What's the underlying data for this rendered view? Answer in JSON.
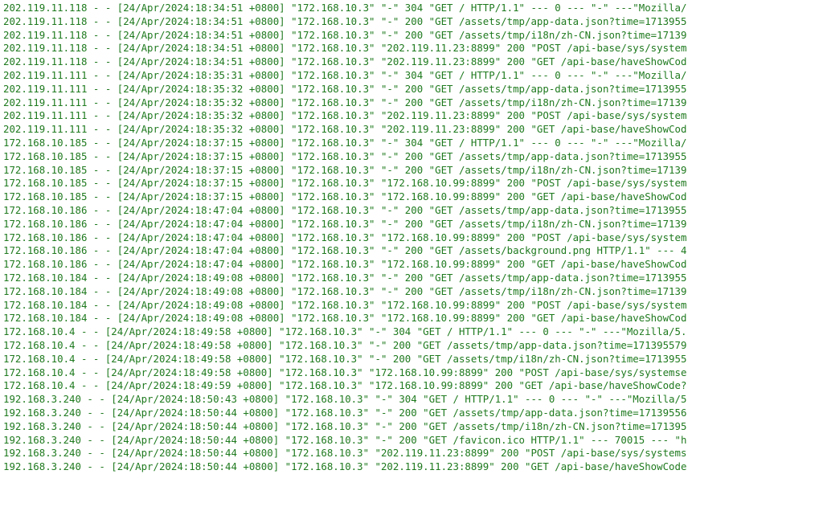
{
  "log_lines": [
    "202.119.11.118 - - [24/Apr/2024:18:34:51 +0800] \"172.168.10.3\" \"-\" 304 \"GET / HTTP/1.1\" --- 0 --- \"-\" ---\"Mozilla/",
    "202.119.11.118 - - [24/Apr/2024:18:34:51 +0800] \"172.168.10.3\" \"-\" 200 \"GET /assets/tmp/app-data.json?time=1713955",
    "202.119.11.118 - - [24/Apr/2024:18:34:51 +0800] \"172.168.10.3\" \"-\" 200 \"GET /assets/tmp/i18n/zh-CN.json?time=17139",
    "202.119.11.118 - - [24/Apr/2024:18:34:51 +0800] \"172.168.10.3\" \"202.119.11.23:8899\" 200 \"POST /api-base/sys/system",
    "202.119.11.118 - - [24/Apr/2024:18:34:51 +0800] \"172.168.10.3\" \"202.119.11.23:8899\" 200 \"GET /api-base/haveShowCod",
    "202.119.11.111 - - [24/Apr/2024:18:35:31 +0800] \"172.168.10.3\" \"-\" 304 \"GET / HTTP/1.1\" --- 0 --- \"-\" ---\"Mozilla/",
    "202.119.11.111 - - [24/Apr/2024:18:35:32 +0800] \"172.168.10.3\" \"-\" 200 \"GET /assets/tmp/app-data.json?time=1713955",
    "202.119.11.111 - - [24/Apr/2024:18:35:32 +0800] \"172.168.10.3\" \"-\" 200 \"GET /assets/tmp/i18n/zh-CN.json?time=17139",
    "202.119.11.111 - - [24/Apr/2024:18:35:32 +0800] \"172.168.10.3\" \"202.119.11.23:8899\" 200 \"POST /api-base/sys/system",
    "202.119.11.111 - - [24/Apr/2024:18:35:32 +0800] \"172.168.10.3\" \"202.119.11.23:8899\" 200 \"GET /api-base/haveShowCod",
    "172.168.10.185 - - [24/Apr/2024:18:37:15 +0800] \"172.168.10.3\" \"-\" 304 \"GET / HTTP/1.1\" --- 0 --- \"-\" ---\"Mozilla/",
    "172.168.10.185 - - [24/Apr/2024:18:37:15 +0800] \"172.168.10.3\" \"-\" 200 \"GET /assets/tmp/app-data.json?time=1713955",
    "172.168.10.185 - - [24/Apr/2024:18:37:15 +0800] \"172.168.10.3\" \"-\" 200 \"GET /assets/tmp/i18n/zh-CN.json?time=17139",
    "172.168.10.185 - - [24/Apr/2024:18:37:15 +0800] \"172.168.10.3\" \"172.168.10.99:8899\" 200 \"POST /api-base/sys/system",
    "172.168.10.185 - - [24/Apr/2024:18:37:15 +0800] \"172.168.10.3\" \"172.168.10.99:8899\" 200 \"GET /api-base/haveShowCod",
    "172.168.10.186 - - [24/Apr/2024:18:47:04 +0800] \"172.168.10.3\" \"-\" 200 \"GET /assets/tmp/app-data.json?time=1713955",
    "172.168.10.186 - - [24/Apr/2024:18:47:04 +0800] \"172.168.10.3\" \"-\" 200 \"GET /assets/tmp/i18n/zh-CN.json?time=17139",
    "172.168.10.186 - - [24/Apr/2024:18:47:04 +0800] \"172.168.10.3\" \"172.168.10.99:8899\" 200 \"POST /api-base/sys/system",
    "172.168.10.186 - - [24/Apr/2024:18:47:04 +0800] \"172.168.10.3\" \"-\" 200 \"GET /assets/background.png HTTP/1.1\" --- 4",
    "172.168.10.186 - - [24/Apr/2024:18:47:04 +0800] \"172.168.10.3\" \"172.168.10.99:8899\" 200 \"GET /api-base/haveShowCod",
    "172.168.10.184 - - [24/Apr/2024:18:49:08 +0800] \"172.168.10.3\" \"-\" 200 \"GET /assets/tmp/app-data.json?time=1713955",
    "172.168.10.184 - - [24/Apr/2024:18:49:08 +0800] \"172.168.10.3\" \"-\" 200 \"GET /assets/tmp/i18n/zh-CN.json?time=17139",
    "172.168.10.184 - - [24/Apr/2024:18:49:08 +0800] \"172.168.10.3\" \"172.168.10.99:8899\" 200 \"POST /api-base/sys/system",
    "172.168.10.184 - - [24/Apr/2024:18:49:08 +0800] \"172.168.10.3\" \"172.168.10.99:8899\" 200 \"GET /api-base/haveShowCod",
    "172.168.10.4 - - [24/Apr/2024:18:49:58 +0800] \"172.168.10.3\" \"-\" 304 \"GET / HTTP/1.1\" --- 0 --- \"-\" ---\"Mozilla/5.",
    "172.168.10.4 - - [24/Apr/2024:18:49:58 +0800] \"172.168.10.3\" \"-\" 200 \"GET /assets/tmp/app-data.json?time=171395579",
    "172.168.10.4 - - [24/Apr/2024:18:49:58 +0800] \"172.168.10.3\" \"-\" 200 \"GET /assets/tmp/i18n/zh-CN.json?time=1713955",
    "172.168.10.4 - - [24/Apr/2024:18:49:58 +0800] \"172.168.10.3\" \"172.168.10.99:8899\" 200 \"POST /api-base/sys/systemse",
    "172.168.10.4 - - [24/Apr/2024:18:49:59 +0800] \"172.168.10.3\" \"172.168.10.99:8899\" 200 \"GET /api-base/haveShowCode?",
    "192.168.3.240 - - [24/Apr/2024:18:50:43 +0800] \"172.168.10.3\" \"-\" 304 \"GET / HTTP/1.1\" --- 0 --- \"-\" ---\"Mozilla/5",
    "192.168.3.240 - - [24/Apr/2024:18:50:44 +0800] \"172.168.10.3\" \"-\" 200 \"GET /assets/tmp/app-data.json?time=17139556",
    "192.168.3.240 - - [24/Apr/2024:18:50:44 +0800] \"172.168.10.3\" \"-\" 200 \"GET /assets/tmp/i18n/zh-CN.json?time=171395",
    "192.168.3.240 - - [24/Apr/2024:18:50:44 +0800] \"172.168.10.3\" \"-\" 200 \"GET /favicon.ico HTTP/1.1\" --- 70015 --- \"h",
    "192.168.3.240 - - [24/Apr/2024:18:50:44 +0800] \"172.168.10.3\" \"202.119.11.23:8899\" 200 \"POST /api-base/sys/systems",
    "192.168.3.240 - - [24/Apr/2024:18:50:44 +0800] \"172.168.10.3\" \"202.119.11.23:8899\" 200 \"GET /api-base/haveShowCode",
    ""
  ]
}
